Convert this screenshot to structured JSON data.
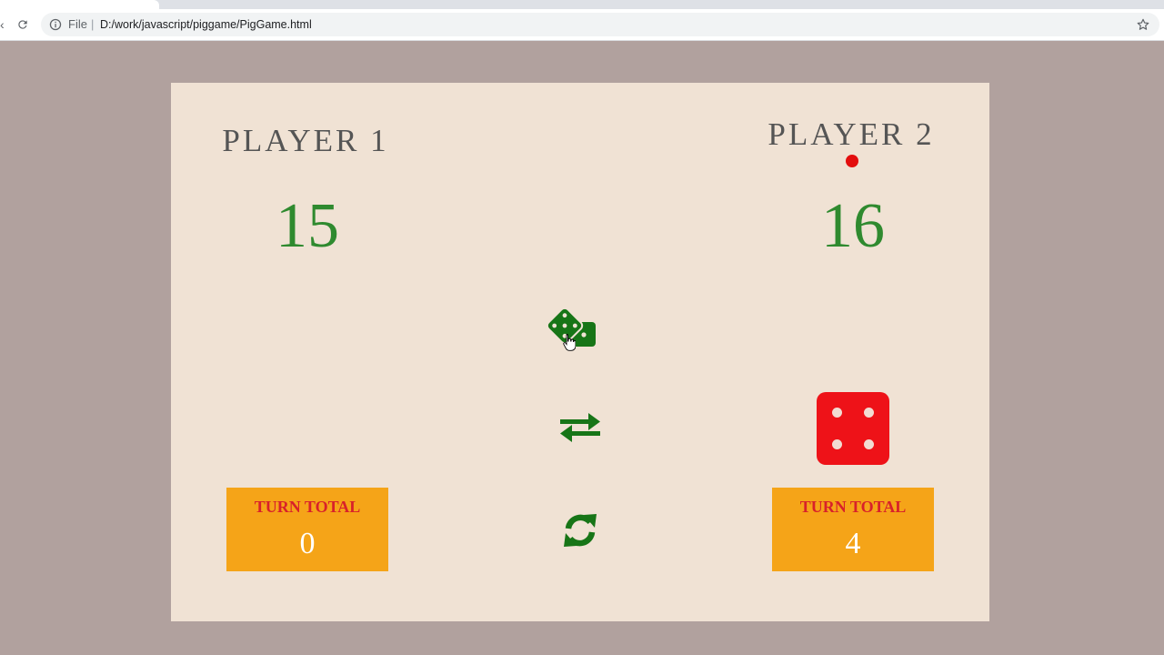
{
  "browser": {
    "file_label": "File",
    "separator": "|",
    "url": "D:/work/javascript/piggame/PigGame.html",
    "icons": [
      "reload-icon",
      "info-icon",
      "star-icon"
    ]
  },
  "game": {
    "player1": {
      "name": "PLAYER 1",
      "score": "15",
      "turn_label": "TURN TOTAL",
      "turn_total": "0"
    },
    "player2": {
      "name": "PLAYER 2",
      "score": "16",
      "turn_label": "TURN TOTAL",
      "turn_total": "4"
    },
    "active_player": 2,
    "die_value": 4,
    "controls": [
      "roll-dice-icon",
      "switch-icon",
      "reset-icon"
    ],
    "colors": {
      "background": "#b1a19e",
      "board": "#f0e2d4",
      "score": "#2f8a2f",
      "controls": "#177517",
      "turn_box": "#f5a418",
      "turn_label": "#d8212a",
      "die": "#ee1218",
      "active_dot": "#e30e0e"
    }
  }
}
